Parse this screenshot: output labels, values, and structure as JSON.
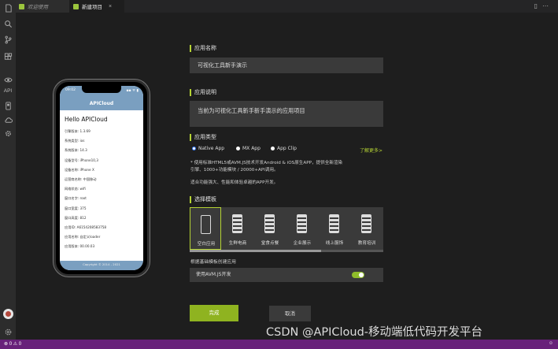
{
  "tabs": {
    "welcome": "欢迎使用",
    "new_project": "新建项目",
    "close": "×"
  },
  "activity_bar": {
    "icons": [
      "files-icon",
      "search-icon",
      "source-control-icon",
      "extensions-icon",
      "eye-icon",
      "api-icon",
      "mobile-icon",
      "cloud-icon",
      "gear-puzzle-icon"
    ],
    "api_label": "API"
  },
  "status_bar": {
    "left": "⊗ 0 ⚠ 0",
    "right": "☺"
  },
  "phone": {
    "time": "09:02",
    "status": "▪▪ ᯤ ▮",
    "title": "APICloud",
    "hello": "Hello APICloud",
    "lines": [
      "引擎版本: 1.3.69",
      "系统类型: ios",
      "系统版本: 14.3",
      "设备型号: iPhone10,3",
      "设备名称: iPhone X",
      "运营商名称: 中国移动",
      "网络状态: wifi",
      "窗口名字: root",
      "窗口宽度: 375",
      "窗口高度: 812",
      "应用ID: A6154208583758",
      "应用名称: 自定义loader",
      "应用版本: 00.00.03"
    ],
    "footer": "Copyright © 2014 - 2021"
  },
  "form": {
    "app_name_label": "应用名称",
    "app_name_value": "可视化工具新手演示",
    "app_desc_label": "应用说明",
    "app_desc_value": "当前为可视化工具新手新手演示的应用项目",
    "app_type_label": "应用类型",
    "app_types": [
      "Native App",
      "MX App",
      "App Clip"
    ],
    "selected_type": "Native App",
    "more_link": "了解更多>",
    "desc_line1": "* 使用标准HTML5或AVM.JS技术开发Android & iOS原生APP，提供全新渲染",
    "desc_line2": "引擎、1000+功能模块 / 20000+API调用。",
    "desc_line3": "适合功能强大、性能和体验卓越的APP开发。",
    "template_label": "选择模板",
    "templates": [
      "空白应用",
      "生鲜电商",
      "堂食点餐",
      "企业展示",
      "线上服饰",
      "教育培训"
    ],
    "selected_template": "空白应用",
    "avm_hint": "根据基础模板创建应用",
    "avm_label": "使用AVM.JS开发",
    "avm_enabled": true,
    "done_button": "完成",
    "cancel_button": "取消"
  },
  "watermark": "CSDN @APICloud-移动端低代码开发平台",
  "colors": {
    "accent": "#b5d334",
    "primary_button": "#8fb320",
    "status_bar": "#68217a",
    "phone_header": "#7a9fc0"
  }
}
